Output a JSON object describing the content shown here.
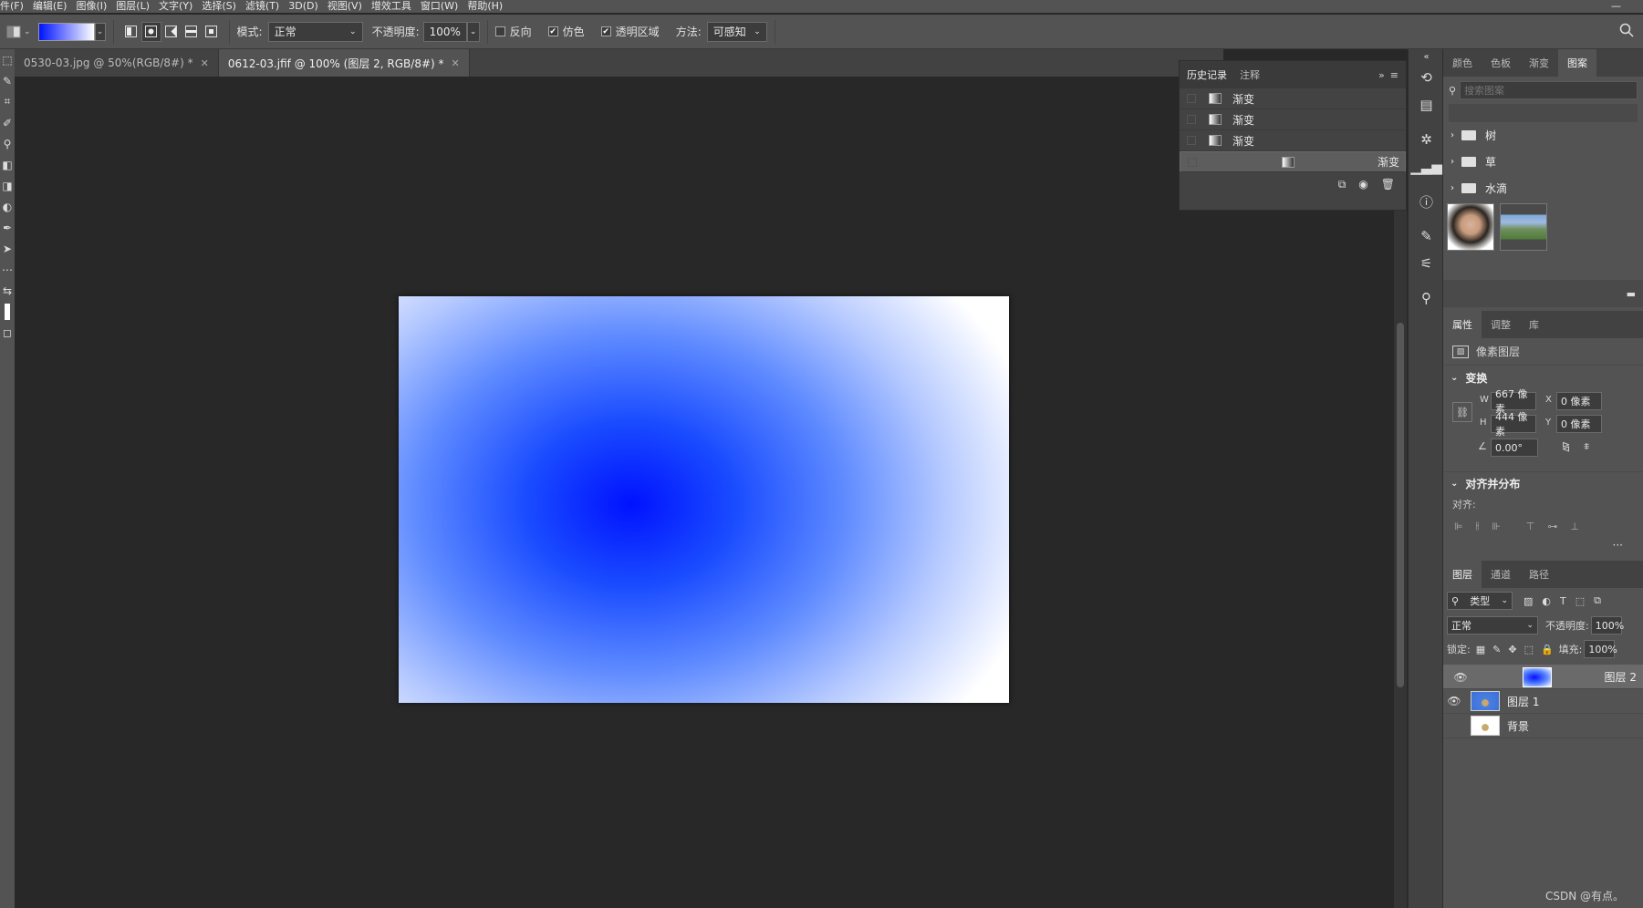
{
  "menubar": {
    "items": [
      "件(F)",
      "编辑(E)",
      "图像(I)",
      "图层(L)",
      "文字(Y)",
      "选择(S)",
      "滤镜(T)",
      "3D(D)",
      "视图(V)",
      "增效工具",
      "窗口(W)",
      "帮助(H)"
    ],
    "minimize": "—"
  },
  "options": {
    "mode_label": "模式:",
    "mode_value": "正常",
    "opacity_label": "不透明度:",
    "opacity_value": "100%",
    "reverse_label": "反向",
    "dither_label": "仿色",
    "transparency_label": "透明区域",
    "method_label": "方法:",
    "method_value": "可感知"
  },
  "tabs": [
    {
      "label": "0530-03.jpg @ 50%(RGB/8#) *"
    },
    {
      "label": "0612-03.jfif @ 100% (图层 2, RGB/8#) *"
    }
  ],
  "history": {
    "tabs": [
      "历史记录",
      "注释"
    ],
    "items": [
      "渐变",
      "渐变",
      "渐变",
      "渐变"
    ]
  },
  "swatches_panel": {
    "tabs": [
      "颜色",
      "色板",
      "渐变",
      "图案"
    ],
    "search_placeholder": "搜索图案",
    "folders": [
      "树",
      "草",
      "水滴"
    ]
  },
  "properties": {
    "tabs": [
      "属性",
      "调整",
      "库"
    ],
    "layer_type": "像素图层",
    "transform_title": "变换",
    "w_label": "W",
    "w_value": "667 像素",
    "h_label": "H",
    "h_value": "444 像素",
    "x_label": "X",
    "x_value": "0 像素",
    "y_label": "Y",
    "y_value": "0 像素",
    "angle_value": "0.00°",
    "align_title": "对齐并分布",
    "align_label": "对齐:"
  },
  "layers_panel": {
    "tabs": [
      "图层",
      "通道",
      "路径"
    ],
    "filter_value": "类型",
    "blend_mode": "正常",
    "opacity_label": "不透明度:",
    "opacity_value": "100%",
    "lock_label": "锁定:",
    "fill_label": "填充:",
    "fill_value": "100%",
    "layers": [
      {
        "name": "图层 2",
        "visible": true,
        "selected": true
      },
      {
        "name": "图层 1",
        "visible": true,
        "selected": false
      },
      {
        "name": "背景",
        "visible": false,
        "selected": false
      }
    ]
  },
  "watermark": "CSDN @有点。",
  "colors": {
    "gradient_center": "#0012ff",
    "gradient_edge": "#ffffff",
    "ui_dark": "#282828",
    "ui_panel": "#535353"
  }
}
